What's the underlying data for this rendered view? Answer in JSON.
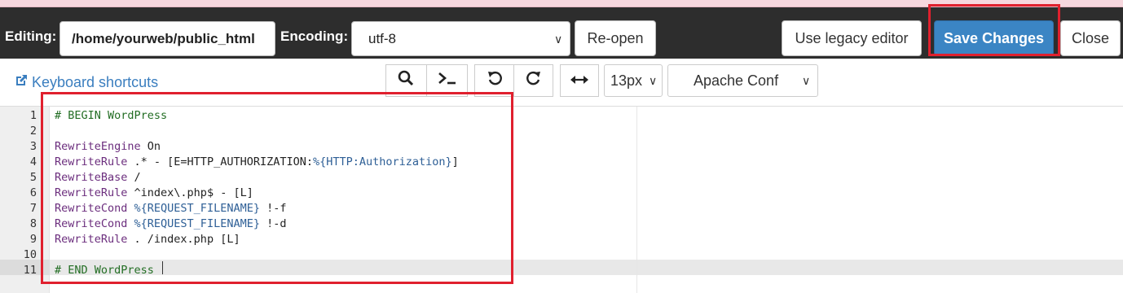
{
  "header": {
    "editing_label": "Editing:",
    "path_value": "/home/yourweb/public_html",
    "encoding_label": "Encoding:",
    "encoding_value": "utf-8",
    "reopen_label": "Re-open",
    "legacy_label": "Use legacy editor",
    "save_label": "Save Changes",
    "close_label": "Close"
  },
  "toolbar": {
    "keyboard_shortcuts": "Keyboard shortcuts",
    "font_size": "13px",
    "mode": "Apache Conf",
    "icons": [
      "search-icon",
      "terminal-icon",
      "undo-icon",
      "redo-icon",
      "wrap-icon"
    ]
  },
  "editor": {
    "line_numbers": [
      "1",
      "2",
      "3",
      "4",
      "5",
      "6",
      "7",
      "8",
      "9",
      "10",
      "11"
    ],
    "active_line": "11",
    "lines": [
      {
        "text": "# BEGIN WordPress"
      },
      {
        "text": ""
      },
      {
        "kw": "RewriteEngine",
        "rest": " On"
      },
      {
        "kw": "RewriteRule",
        "rest": " .* - [E=HTTP_AUTHORIZATION:",
        "var": "%{HTTP:Authorization}",
        "tail": "]"
      },
      {
        "kw": "RewriteBase",
        "rest": " /"
      },
      {
        "kw": "RewriteRule",
        "rest": " ^index\\.php$ - [L]"
      },
      {
        "kw": "RewriteCond",
        "var": " %{REQUEST_FILENAME}",
        "rest": " !-f"
      },
      {
        "kw": "RewriteCond",
        "var": " %{REQUEST_FILENAME}",
        "rest": " !-d"
      },
      {
        "kw": "RewriteRule",
        "rest": " . /index.php [L]"
      },
      {
        "text": ""
      },
      {
        "text": "# END WordPress"
      }
    ]
  },
  "colors": {
    "topbar": "#2d2d2d",
    "save_button": "#3b85c4",
    "highlight_box": "#e0202e",
    "comment": "#236e24",
    "keyword": "#6b2d7d"
  }
}
